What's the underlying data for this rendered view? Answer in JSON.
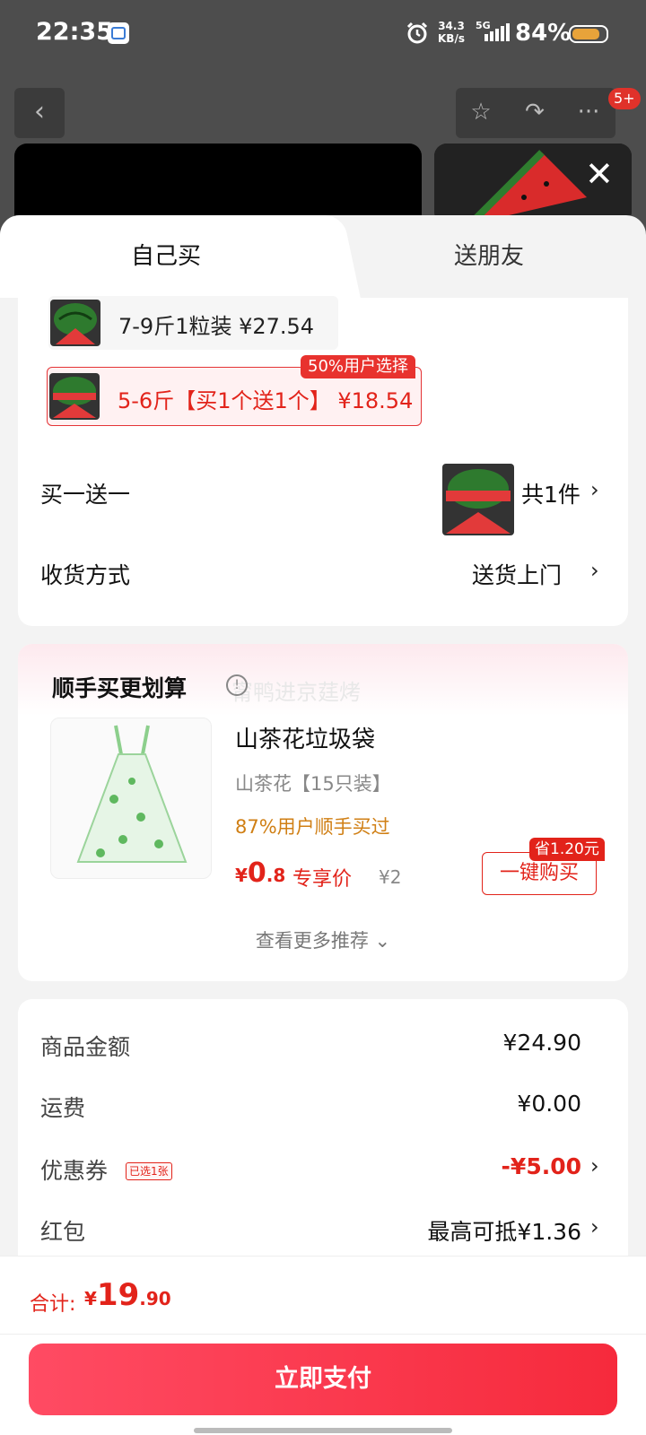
{
  "status_bar": {
    "time": "22:35",
    "net_speed": "34.3",
    "net_speed_unit": "KB/s",
    "network": "5G",
    "battery": "84%",
    "battery_level": 0.84
  },
  "background": {
    "badge": "5+"
  },
  "tabs": {
    "self": "自己买",
    "friend": "送朋友"
  },
  "skus": [
    {
      "label": "7-9斤1粒装  ¥27.54",
      "selected": false
    },
    {
      "label": "5-6斤【买1个送1个】  ¥18.54",
      "selected": true
    }
  ],
  "sku_badge": "50%用户选择",
  "promo_row": {
    "label": "买一送一",
    "count": "共1件"
  },
  "delivery_row": {
    "label": "收货方式",
    "value": "送货上门"
  },
  "upsell": {
    "title": "顺手买更划算",
    "watermark": "甯鸭进京莛烤",
    "product": {
      "name": "山茶花垃圾袋",
      "spec": "山茶花【15只装】",
      "social_proof": "87%用户顺手买过",
      "price_yen": "¥",
      "price_int": "0",
      "price_dec": ".8",
      "price_label": "专享价",
      "original_price": "¥2",
      "buy_button": "一键购买",
      "save_badge": "省1.20元"
    },
    "more": "查看更多推荐 ⌄"
  },
  "fees": {
    "goods_label": "商品金额",
    "goods_value": "¥24.90",
    "shipping_label": "运费",
    "shipping_value": "¥0.00",
    "coupon_label": "优惠券",
    "coupon_tag": "已选1张",
    "coupon_value": "-¥5.00",
    "redpacket_label": "红包",
    "redpacket_value": "最高可抵¥1.36"
  },
  "footer": {
    "total_label": "合计:",
    "total_yen": "¥",
    "total_int": "19",
    "total_dec": ".90",
    "pay_button": "立即支付"
  },
  "colors": {
    "accent_red": "#e2231a",
    "pay_gradient_start": "#ff4b63",
    "pay_gradient_end": "#f62a3c",
    "social_proof_orange": "#d07f14"
  }
}
